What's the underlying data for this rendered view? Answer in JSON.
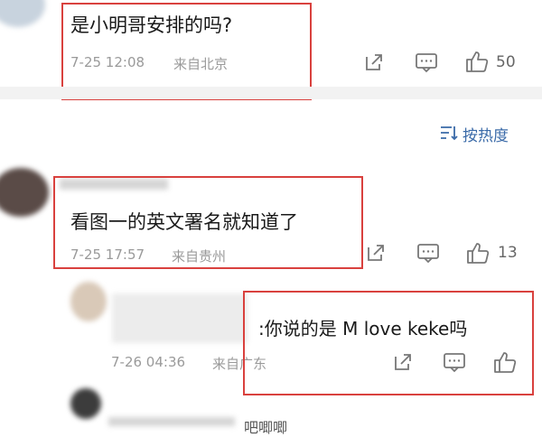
{
  "comments": [
    {
      "text": "是小明哥安排的吗?",
      "time": "7-25 12:08",
      "location": "来自北京",
      "likes": "50"
    },
    {
      "text": "看图一的英文署名就知道了",
      "time": "7-25 17:57",
      "location": "来自贵州",
      "likes": "13"
    }
  ],
  "reply": {
    "text": ":你说的是 M love keke吗",
    "time": "7-26 04:36",
    "location": "来自广东"
  },
  "sort_label": "按热度",
  "bottom_partial": "吧唧唧"
}
